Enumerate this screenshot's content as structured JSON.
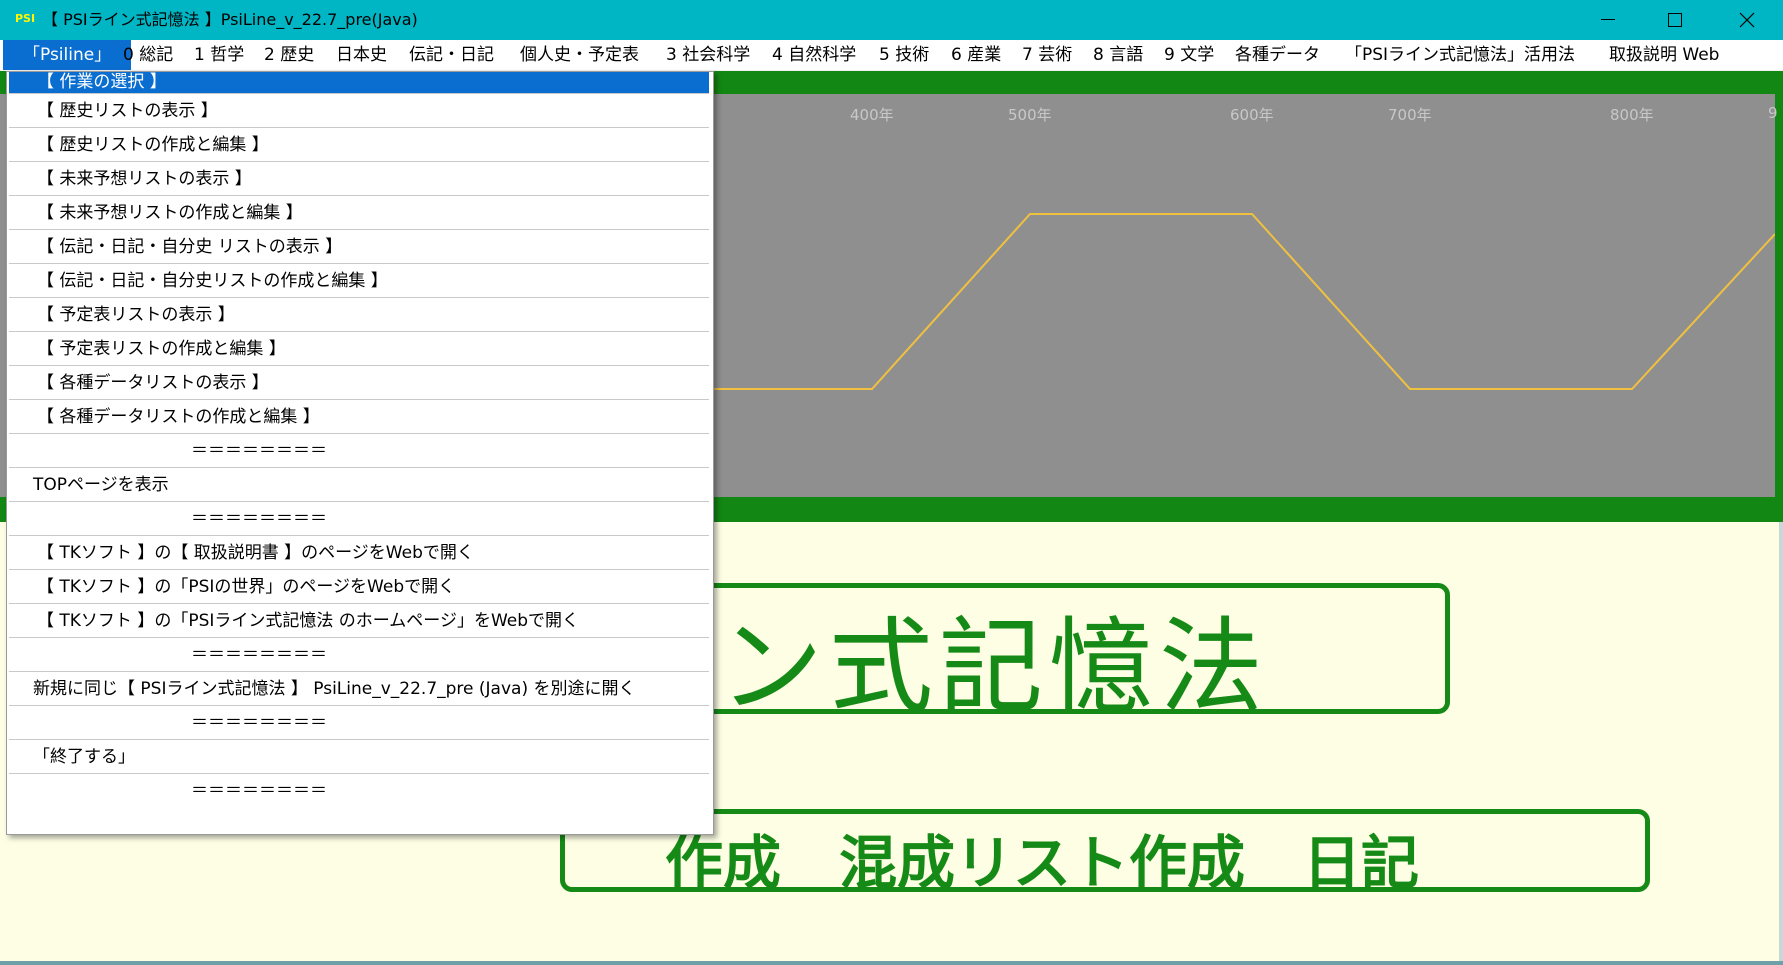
{
  "window": {
    "title": "【 PSIライン式記憶法 】PsiLine_v_22.7_pre(Java)",
    "icon_label": "PSI",
    "accent": "#00b5c4"
  },
  "menubar": {
    "items": [
      {
        "label": "「Psiline」"
      },
      {
        "label": "0 総記"
      },
      {
        "label": "1 哲学"
      },
      {
        "label": "2 歴史"
      },
      {
        "label": "日本史"
      },
      {
        "label": "伝記・日記"
      },
      {
        "label": "個人史・予定表"
      },
      {
        "label": "3 社会科学"
      },
      {
        "label": "4 自然科学"
      },
      {
        "label": "5 技術"
      },
      {
        "label": "6 産業"
      },
      {
        "label": "7 芸術"
      },
      {
        "label": "8 言語"
      },
      {
        "label": "9 文学"
      },
      {
        "label": "各種データ"
      },
      {
        "label": "「PSIライン式記憶法」活用法"
      },
      {
        "label": "取扱説明 Web"
      }
    ]
  },
  "dropdown": {
    "items": [
      "【 作業の選択 】",
      "【 歴史リストの表示 】",
      "【 歴史リストの作成と編集 】",
      "【 未来予想リストの表示 】",
      "【 未来予想リストの作成と編集 】",
      "【 伝記・日記・自分史 リストの表示 】",
      "【 伝記・日記・自分史リストの作成と編集 】",
      "【 予定表リストの表示 】",
      "【 予定表リストの作成と編集 】",
      "【 各種データリストの表示 】",
      "【 各種データリストの作成と編集 】",
      "＝＝＝＝＝＝＝＝",
      "TOPページを表示",
      "＝＝＝＝＝＝＝＝",
      "【 TKソフト 】の【 取扱説明書 】のページをWebで開く",
      "【 TKソフト 】の「PSIの世界」のページをWebで開く",
      "【 TKソフト 】の「PSIライン式記憶法 のホームページ」をWebで開く",
      "＝＝＝＝＝＝＝＝",
      "新規に同じ【 PSIライン式記憶法 】 PsiLine_v_22.7_pre (Java) を別途に開く",
      "＝＝＝＝＝＝＝＝",
      "「終了する」",
      "＝＝＝＝＝＝＝＝"
    ]
  },
  "chart": {
    "tick_labels": [
      "400年",
      "500年",
      "600年",
      "700年",
      "800年",
      "9"
    ],
    "line_color": "#f0c040",
    "background": "#8f8f8f",
    "frame_color": "#138713"
  },
  "banners": {
    "title": "イン式記憶法",
    "subtitle": "作成　混成リスト作成　日記"
  }
}
